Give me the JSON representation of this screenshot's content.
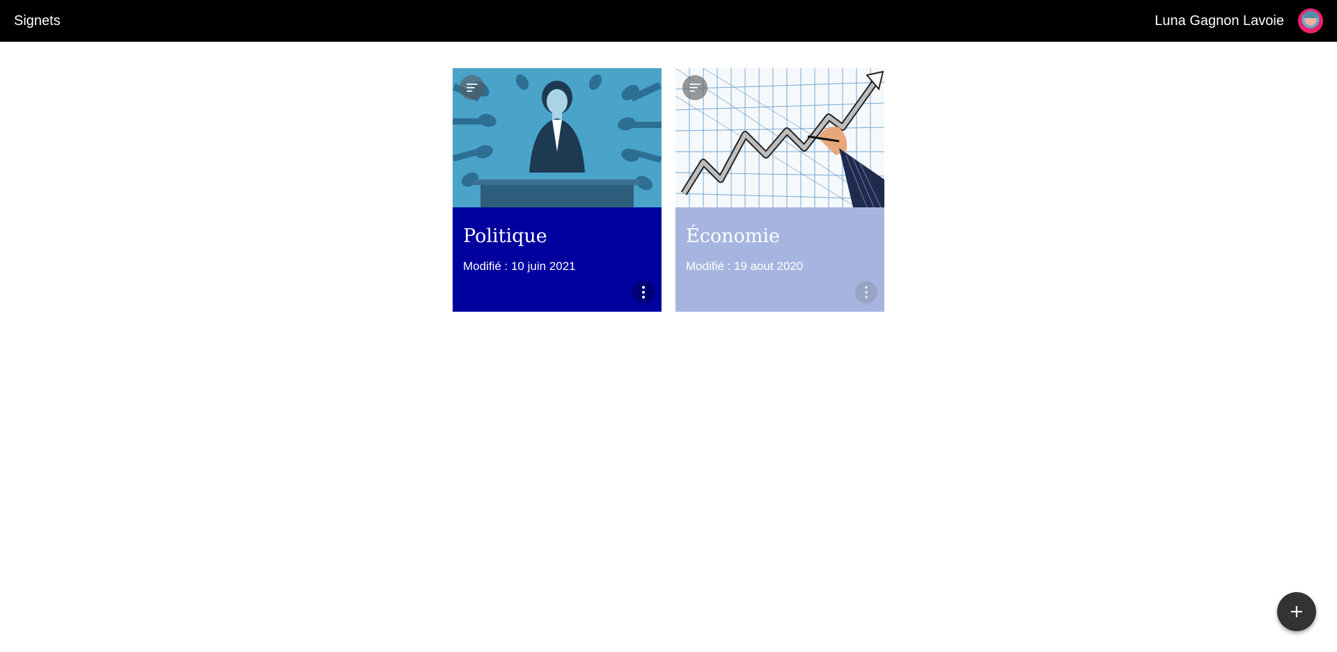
{
  "header": {
    "app_title": "Signets",
    "user_name": "Luna Gagnon Lavoie",
    "avatar_icon": "user-avatar"
  },
  "cards": [
    {
      "title": "Politique",
      "modified": "Modifié : 10 juin 2021",
      "image": "politician-at-podium-illustration",
      "body_color": "#00009e"
    },
    {
      "title": "Économie",
      "modified": "Modifié : 19 aout 2020",
      "image": "rising-graph-hand-drawing",
      "body_color": "#a6b5df"
    }
  ],
  "fab": {
    "icon": "plus-icon"
  }
}
